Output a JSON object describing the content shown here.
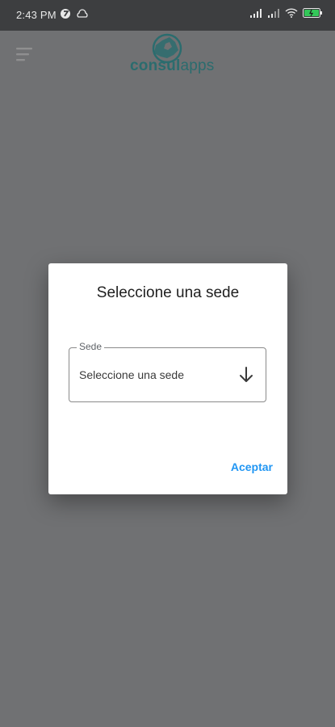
{
  "status_bar": {
    "time": "2:43 PM",
    "icons": [
      "app-notification-icon",
      "cloud-icon",
      "signal-icon",
      "signal-icon",
      "wifi-icon",
      "battery-icon"
    ],
    "battery_color": "#34c759"
  },
  "app_bar": {
    "logo_text_bold": "consul",
    "logo_text_light": "apps",
    "logo_color": "#2b6c6e"
  },
  "dialog": {
    "title": "Seleccione una sede",
    "field": {
      "label": "Sede",
      "value": "Seleccione una sede"
    },
    "accept_label": "Aceptar",
    "accent_color": "#2196f3"
  }
}
